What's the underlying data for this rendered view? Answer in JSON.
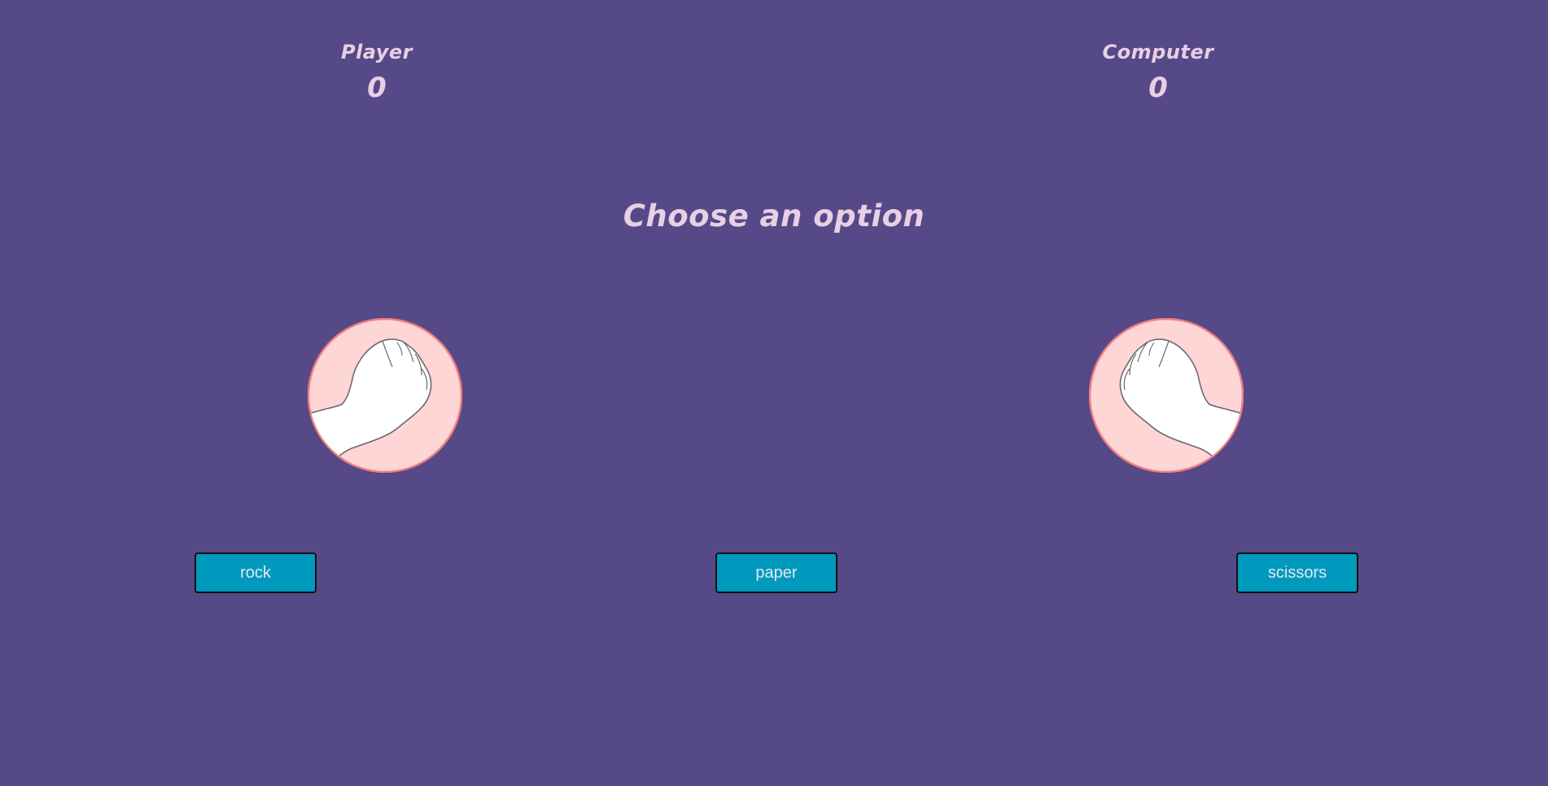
{
  "scoreboard": {
    "player": {
      "label": "Player",
      "score": "0"
    },
    "computer": {
      "label": "Computer",
      "score": "0"
    }
  },
  "prompt": "Choose an option",
  "hands": {
    "player": {
      "icon": "fist-icon",
      "fill": "#ffd6d6",
      "stroke": "#f08080"
    },
    "computer": {
      "icon": "fist-icon",
      "fill": "#ffd6d6",
      "stroke": "#f08080"
    }
  },
  "choices": {
    "rock": "rock",
    "paper": "paper",
    "scissors": "scissors"
  },
  "colors": {
    "background": "#564987",
    "text": "#e9cfe4",
    "button": "#009abe"
  }
}
